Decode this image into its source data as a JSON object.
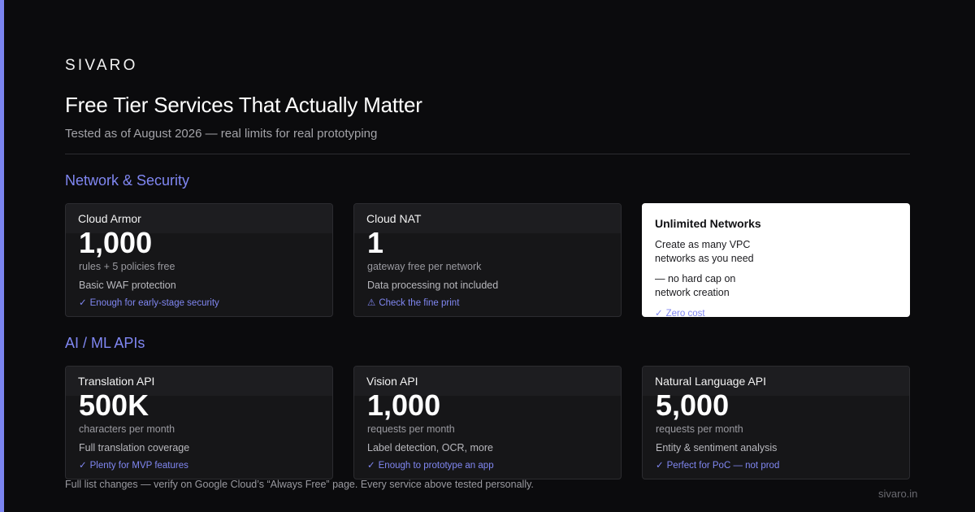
{
  "brand": "SIVARO",
  "title": "Free Tier Services That Actually Matter",
  "subtitle": "Tested as of August 2026 — real limits for real prototyping",
  "sections": [
    {
      "heading": "Network & Security",
      "cards": [
        {
          "name": "Cloud Armor",
          "value": "1,000",
          "unit": "rules + 5 policies free",
          "desc": "Basic WAF protection",
          "note_icon": "✓",
          "note": "Enough for early-stage security"
        },
        {
          "name": "Cloud NAT",
          "value": "1",
          "unit": "gateway free per network",
          "desc": "Data processing not included",
          "note_icon": "⚠",
          "note": "Check the fine print"
        }
      ],
      "highlight": {
        "title": "Unlimited Networks",
        "line1a": "Create as many VPC",
        "line1b": "networks as you need",
        "line2a": "— no hard cap on",
        "line2b": "network creation",
        "note_icon": "✓",
        "note": "Zero cost"
      }
    },
    {
      "heading": "AI / ML APIs",
      "cards": [
        {
          "name": "Translation API",
          "value": "500K",
          "unit": "characters per month",
          "desc": "Full translation coverage",
          "note_icon": "✓",
          "note": "Plenty for MVP features"
        },
        {
          "name": "Vision API",
          "value": "1,000",
          "unit": "requests per month",
          "desc": "Label detection, OCR, more",
          "note_icon": "✓",
          "note": "Enough to prototype an app"
        },
        {
          "name": "Natural Language API",
          "value": "5,000",
          "unit": "requests per month",
          "desc": "Entity & sentiment analysis",
          "note_icon": "✓",
          "note": "Perfect for PoC — not prod"
        }
      ]
    }
  ],
  "footnote": "Full list changes — verify on Google Cloud’s “Always Free” page. Every service above tested personally.",
  "site": "sivaro.in",
  "colors": {
    "accent": "#7b84f0",
    "background": "#0b0b0d",
    "card": "#161618",
    "highlight_card": "#ffffff"
  }
}
